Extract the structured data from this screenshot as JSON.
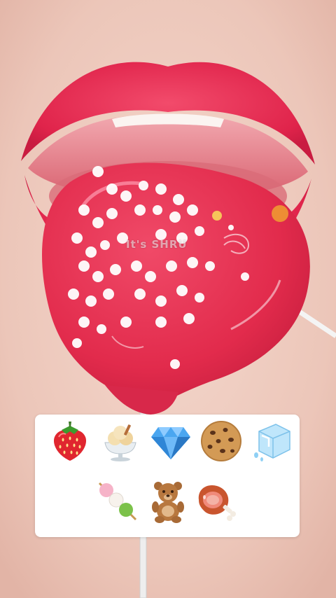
{
  "watermark": "It's SHRU",
  "colors": {
    "lip": "#e8284f",
    "candy": "#e8304f",
    "sprinkle": "#ffffff",
    "skin": "#f0cfc4",
    "panel": "#ffffff"
  },
  "emoji_panel": {
    "row1": [
      "strawberry-icon",
      "ice-cream-sundae-icon",
      "gem-stone-icon",
      "cookie-icon",
      "ice-cube-icon"
    ],
    "row2": [
      "dango-icon",
      "teddy-bear-icon",
      "meat-on-bone-icon"
    ]
  }
}
